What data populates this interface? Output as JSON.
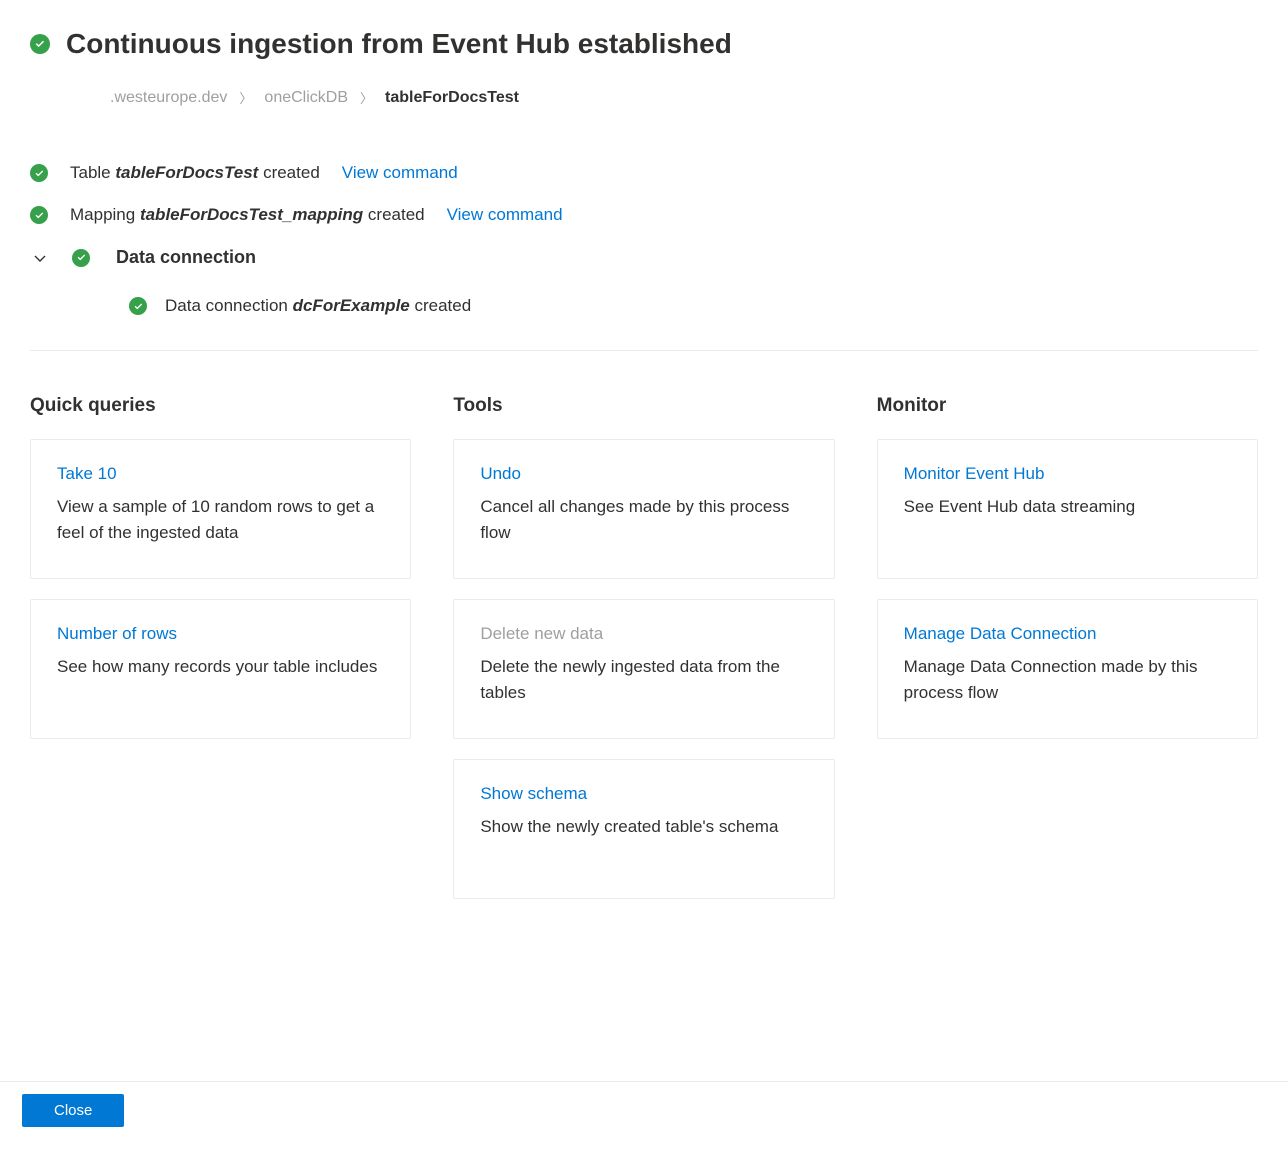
{
  "header": {
    "title": "Continuous ingestion from Event Hub established"
  },
  "breadcrumb": {
    "cluster": ".westeurope.dev",
    "database": "oneClickDB",
    "table": "tableForDocsTest"
  },
  "status": {
    "table": {
      "prefix": "Table ",
      "name": "tableForDocsTest",
      "suffix": " created",
      "view_command": "View command"
    },
    "mapping": {
      "prefix": "Mapping ",
      "name": "tableForDocsTest_mapping",
      "suffix": " created",
      "view_command": "View command"
    },
    "data_connection": {
      "heading": "Data connection",
      "sub": {
        "prefix": "Data connection ",
        "name": "dcForExample",
        "suffix": " created"
      }
    }
  },
  "columns": {
    "quick_queries": {
      "heading": "Quick queries",
      "cards": [
        {
          "title": "Take 10",
          "desc": "View a sample of 10 random rows to get a feel of the ingested data",
          "enabled": true
        },
        {
          "title": "Number of rows",
          "desc": "See how many records your table includes",
          "enabled": true
        }
      ]
    },
    "tools": {
      "heading": "Tools",
      "cards": [
        {
          "title": "Undo",
          "desc": "Cancel all changes made by this process flow",
          "enabled": true
        },
        {
          "title": "Delete new data",
          "desc": "Delete the newly ingested data from the tables",
          "enabled": false
        },
        {
          "title": "Show schema",
          "desc": "Show the newly created table's schema",
          "enabled": true
        }
      ]
    },
    "monitor": {
      "heading": "Monitor",
      "cards": [
        {
          "title": "Monitor Event Hub",
          "desc": "See Event Hub data streaming",
          "enabled": true
        },
        {
          "title": "Manage Data Connection",
          "desc": "Manage Data Connection made by this process flow",
          "enabled": true
        }
      ]
    }
  },
  "footer": {
    "close": "Close"
  }
}
